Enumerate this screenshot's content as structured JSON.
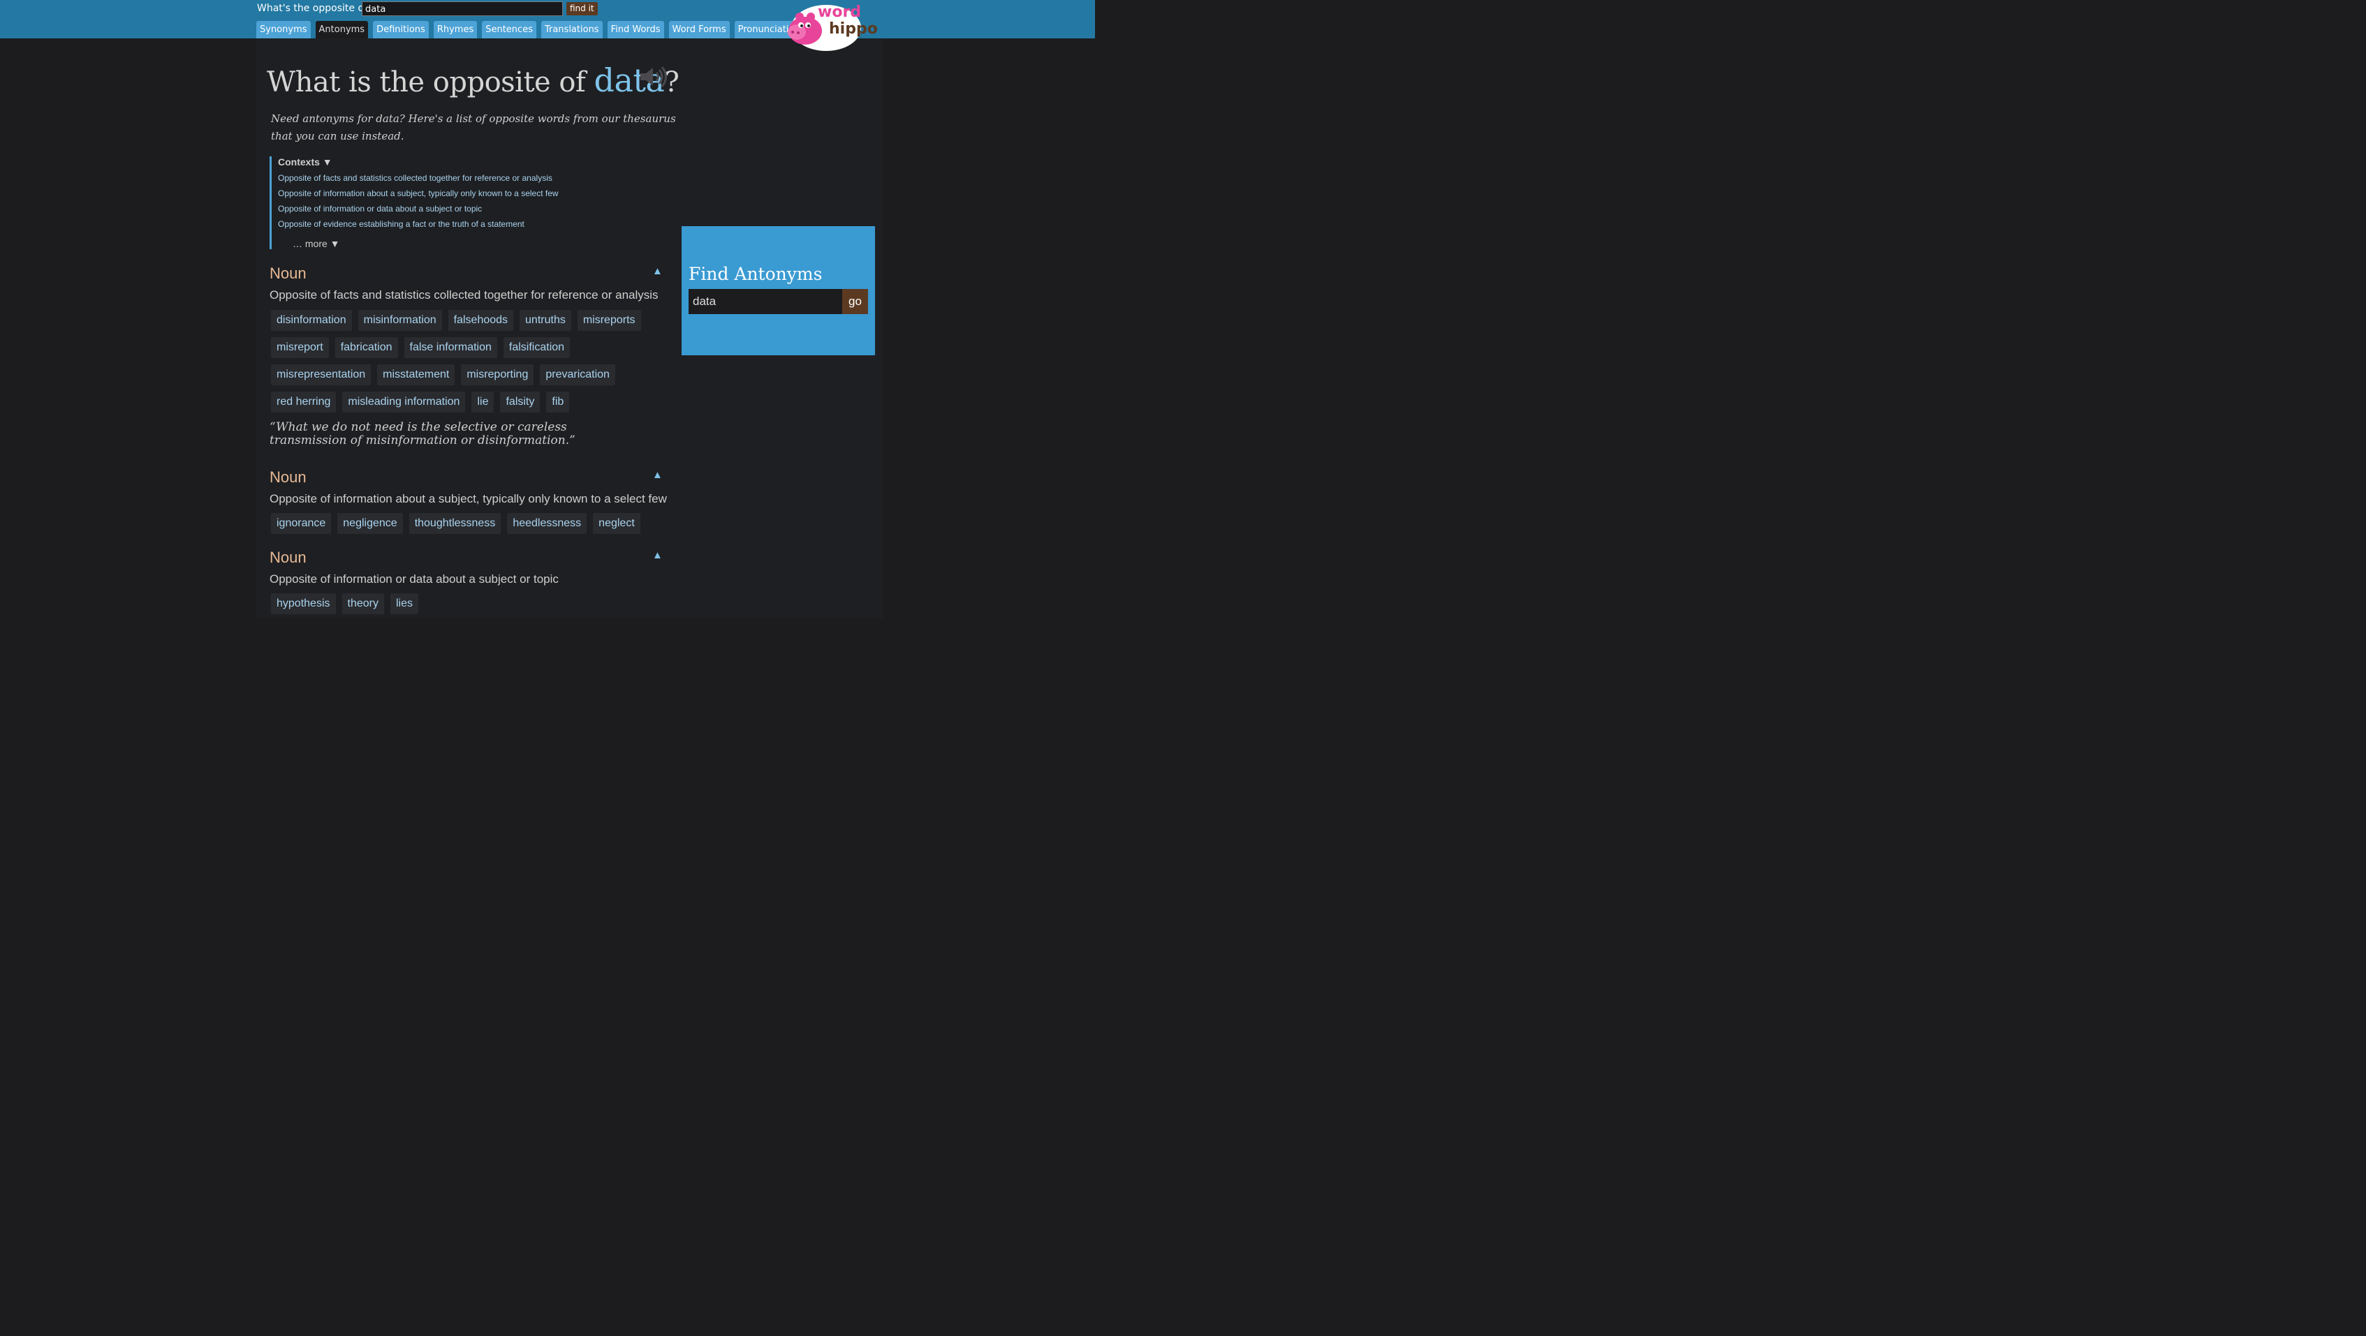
{
  "header": {
    "search_label": "What's the opposite of",
    "search_value": "data",
    "find_button": "find it",
    "tabs": [
      {
        "label": "Synonyms",
        "active": false
      },
      {
        "label": "Antonyms",
        "active": true
      },
      {
        "label": "Definitions",
        "active": false
      },
      {
        "label": "Rhymes",
        "active": false
      },
      {
        "label": "Sentences",
        "active": false
      },
      {
        "label": "Translations",
        "active": false
      },
      {
        "label": "Find Words",
        "active": false
      },
      {
        "label": "Word Forms",
        "active": false
      },
      {
        "label": "Pronunciations",
        "active": false
      }
    ],
    "logo_text_top": "word",
    "logo_text_bottom": "hippo"
  },
  "main": {
    "title_prefix": "What is the opposite of ",
    "title_word": "data",
    "title_suffix": "?",
    "intro": "Need antonyms for data? Here's a list of opposite words from our thesaurus that you can use instead.",
    "contexts_title": "Contexts ▼",
    "contexts": [
      "Opposite of facts and statistics collected together for reference or analysis",
      "Opposite of information about a subject, typically only known to a select few",
      "Opposite of information or data about a subject or topic",
      "Opposite of evidence establishing a fact or the truth of a statement"
    ],
    "more_label": "… more ▼",
    "sections": [
      {
        "pos": "Noun",
        "sense": "Opposite of facts and statistics collected together for reference or analysis",
        "words": [
          "disinformation",
          "misinformation",
          "falsehoods",
          "untruths",
          "misreports",
          "misreport",
          "fabrication",
          "false information",
          "falsification",
          "misrepresentation",
          "misstatement",
          "misreporting",
          "prevarication",
          "red herring",
          "misleading information",
          "lie",
          "falsity",
          "fib"
        ],
        "quote": "“What we do not need is the selective or careless transmission of misinformation or disinformation.”"
      },
      {
        "pos": "Noun",
        "sense": "Opposite of information about a subject, typically only known to a select few",
        "words": [
          "ignorance",
          "negligence",
          "thoughtlessness",
          "heedlessness",
          "neglect"
        ]
      },
      {
        "pos": "Noun",
        "sense": "Opposite of information or data about a subject or topic",
        "words": [
          "hypothesis",
          "theory",
          "lies"
        ]
      }
    ]
  },
  "side": {
    "title": "Find Antonyms",
    "input_value": "data",
    "go_label": "go"
  },
  "colors": {
    "header_bg": "#2379a3",
    "tab_bg": "#4da3d6",
    "accent_word": "#7ec3ea",
    "pos_color": "#e7b995",
    "button_brown": "#5c3a22",
    "side_bg": "#3a9ad2"
  }
}
